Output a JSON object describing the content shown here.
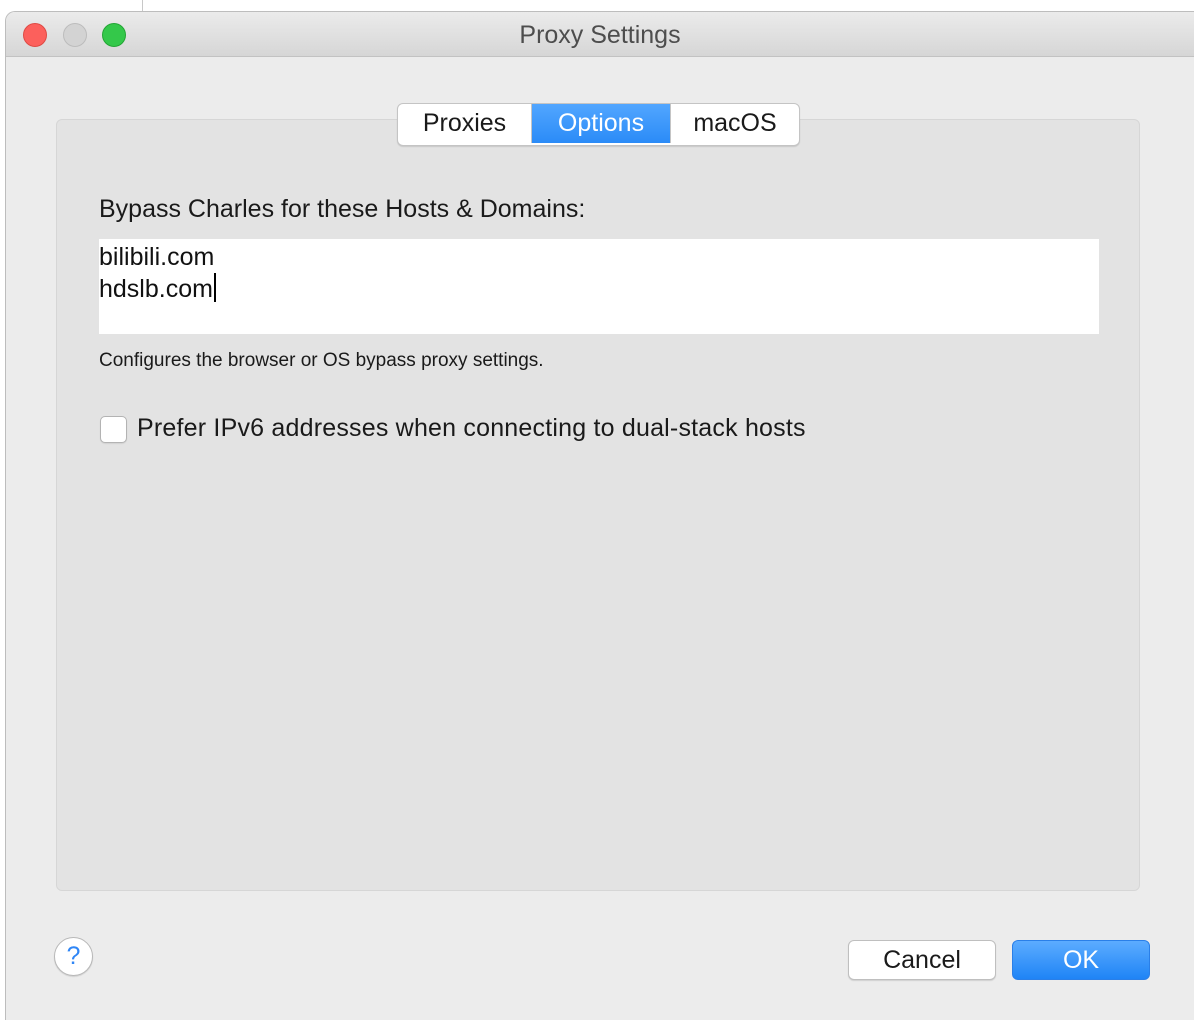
{
  "window": {
    "title": "Proxy Settings"
  },
  "tabs": [
    {
      "label": "Proxies",
      "selected": false
    },
    {
      "label": "Options",
      "selected": true
    },
    {
      "label": "macOS",
      "selected": false
    }
  ],
  "options": {
    "bypass_label": "Bypass Charles for these Hosts & Domains:",
    "bypass_hosts": [
      "bilibili.com",
      "hdslb.com"
    ],
    "hint": "Configures the browser or OS bypass proxy settings.",
    "ipv6_checkbox": {
      "label": "Prefer IPv6 addresses when connecting to dual-stack hosts",
      "checked": false
    }
  },
  "footer": {
    "help_symbol": "?",
    "cancel_label": "Cancel",
    "ok_label": "OK"
  },
  "colors": {
    "accent": "#2b8bf7",
    "close": "#fc605c",
    "minimize": "#d3d3d3",
    "maximize": "#34c84a"
  }
}
